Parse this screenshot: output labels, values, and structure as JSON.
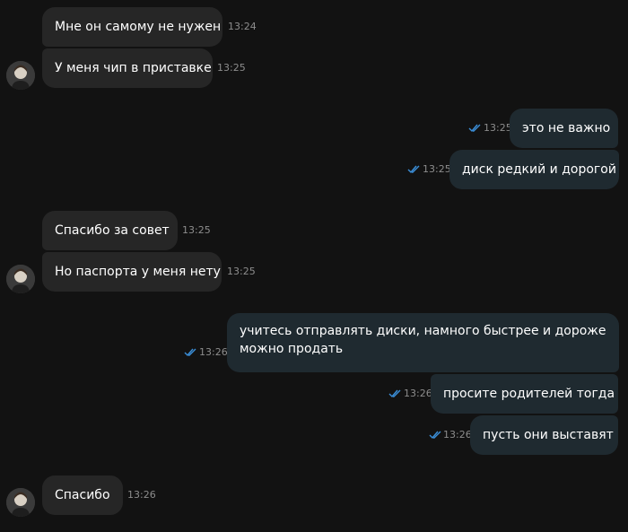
{
  "colors": {
    "background": "#121212",
    "incoming_bubble": "#262626",
    "outgoing_bubble": "#1f2a30",
    "timestamp": "#8d8d8d",
    "read_ticks": "#3b8fd9"
  },
  "messages": [
    {
      "direction": "in",
      "text": "Мне он самому не нужен",
      "time": "13:24"
    },
    {
      "direction": "in",
      "text": "У меня чип в приставке",
      "time": "13:25",
      "avatar": "avatar-icon"
    },
    {
      "direction": "out",
      "text": "это не важно",
      "time": "13:25",
      "status": "read-double-check-icon"
    },
    {
      "direction": "out",
      "text": "диск редкий и дорогой",
      "time": "13:25",
      "status": "read-double-check-icon"
    },
    {
      "direction": "in",
      "text": "Спасибо за совет",
      "time": "13:25"
    },
    {
      "direction": "in",
      "text": "Но паспорта у меня нету",
      "time": "13:25",
      "avatar": "avatar-icon"
    },
    {
      "direction": "out",
      "text": "учитесь отправлять диски, намного быстрее и дороже можно продать",
      "time": "13:26",
      "status": "read-double-check-icon"
    },
    {
      "direction": "out",
      "text": "просите родителей тогда",
      "time": "13:26",
      "status": "read-double-check-icon"
    },
    {
      "direction": "out",
      "text": "пусть они выставят",
      "time": "13:26",
      "status": "read-double-check-icon"
    },
    {
      "direction": "in",
      "text": "Спасибо",
      "time": "13:26",
      "avatar": "avatar-icon"
    }
  ]
}
